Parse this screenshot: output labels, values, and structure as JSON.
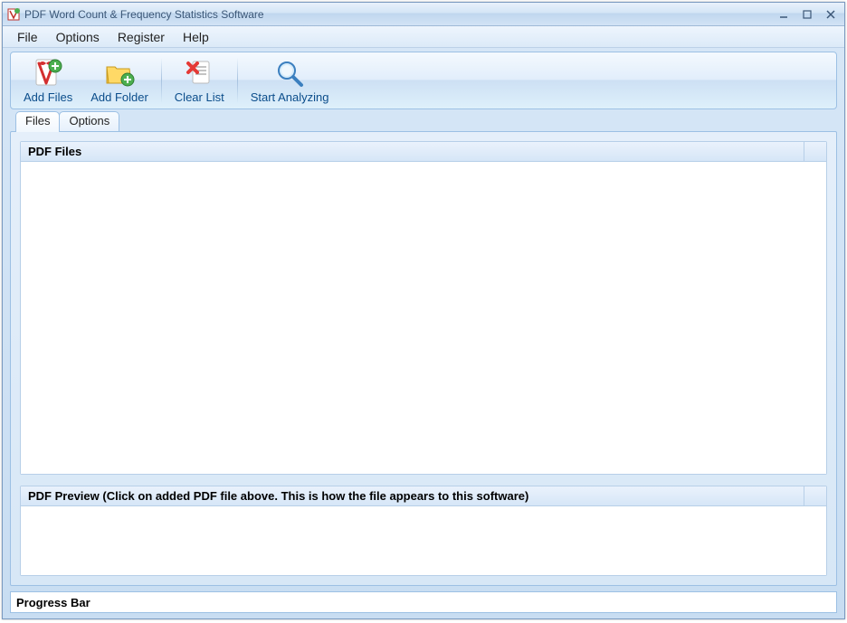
{
  "window": {
    "title": "PDF Word Count & Frequency Statistics Software"
  },
  "menu": {
    "file": "File",
    "options": "Options",
    "register": "Register",
    "help": "Help"
  },
  "toolbar": {
    "add_files": "Add Files",
    "add_folder": "Add Folder",
    "clear_list": "Clear List",
    "start_analyzing": "Start Analyzing"
  },
  "tabs": {
    "files": "Files",
    "options": "Options"
  },
  "groups": {
    "pdf_files": "PDF Files",
    "pdf_preview": "PDF Preview (Click on added PDF file above. This is how the file appears to this software)"
  },
  "progress": {
    "label": "Progress Bar"
  }
}
